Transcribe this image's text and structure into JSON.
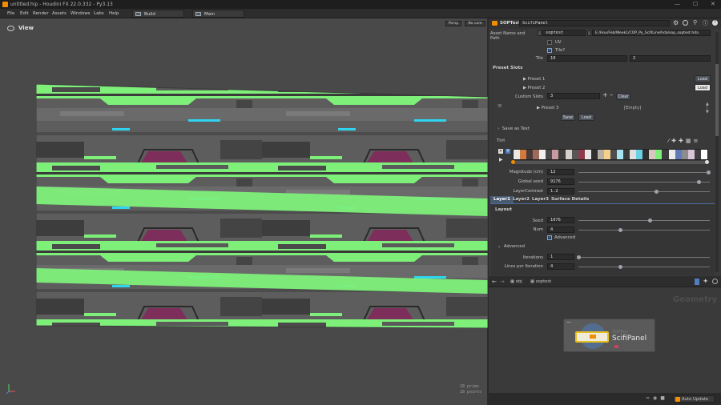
{
  "window": {
    "title": "untitled.hip - Houdini FX 22.0.332 - Py3.13"
  },
  "menu": [
    "File",
    "Edit",
    "Render",
    "Assets",
    "Windows",
    "Labs",
    "Help"
  ],
  "desktops": {
    "build": "Build",
    "main": "Main"
  },
  "viewport": {
    "title": "View",
    "camera_mode": "Persp",
    "camera": "No cam",
    "stats": [
      "28  prims",
      "28  points"
    ]
  },
  "panel": {
    "node_type": "SOPText",
    "node_name": "ScifiPanel",
    "asset": {
      "label": "Asset Name and Path",
      "name": "soptest",
      "path": "E:/Hou/Feb/Week1/COP_Py_ScifiLine/hda/sop_soptest.hda"
    },
    "uv_label": "UV",
    "tile_toggle_label": "Tile?",
    "tile_label": "Tile",
    "tile_x": "10",
    "tile_y": "2",
    "preset_section": "Preset Slots",
    "presets": [
      "Preset 1",
      "Preset 2",
      "Preset 3"
    ],
    "load_label": "Load",
    "custom_slots_label": "Custom Slots",
    "custom_slots": "3",
    "clear_label": "Clear",
    "empty_label": "[Empty]",
    "save_label": "Save",
    "save_as_text": "Save as Text",
    "tint_label": "Tint",
    "magnitude_label": "Magnitude (cm)",
    "magnitude": "12",
    "seed_label": "Global seed",
    "seed": "9176",
    "contrast_label": "LayerContrast",
    "contrast": "1.2",
    "tabs": [
      "Layer1",
      "Layer2",
      "Layer3",
      "Surface Details"
    ],
    "layout_section": "Layout",
    "layer_seed_label": "Seed",
    "layer_seed": "1076",
    "num_label": "Num",
    "num": "4",
    "advanced_label": "Advanced",
    "advanced_section": "Advanced",
    "iterations_label": "Iterations",
    "iterations": "1",
    "lines_label": "Lines per Iteration",
    "lines": "4"
  },
  "network": {
    "path": [
      "obj",
      "soptest"
    ],
    "context": "Geometry",
    "node_label": "ScifiPanel",
    "node_type_label": "SOPText"
  },
  "status": {
    "auto_update": "Auto Update"
  },
  "colors": {
    "accent": "#f28c00",
    "green": "#7ef07a",
    "panel_bg": "#393939",
    "select": "#4f7dbd"
  },
  "tint_swatches": [
    "#e8e8e8",
    "#d47a3c",
    "#4a3a38",
    "#9e6a5a",
    "#f0f0f0",
    "#4a4a4a",
    "#c89aa0",
    "#3c3c3c",
    "#d8d0c8",
    "#565656",
    "#8f3a4a",
    "#e6e6e6",
    "#2f2f2f",
    "#b7b0a8",
    "#f5d08a",
    "#4d4d4d",
    "#a8e4f0",
    "#3a3a3a",
    "#e0e0e0",
    "#6ad0e6",
    "#2e2e2e",
    "#d6c8c0",
    "#7ef07a",
    "#3b3b3b",
    "#ececec",
    "#5e7bb8",
    "#8c8c8c",
    "#d9c4d8",
    "#3f3f3f",
    "#ffffff"
  ]
}
